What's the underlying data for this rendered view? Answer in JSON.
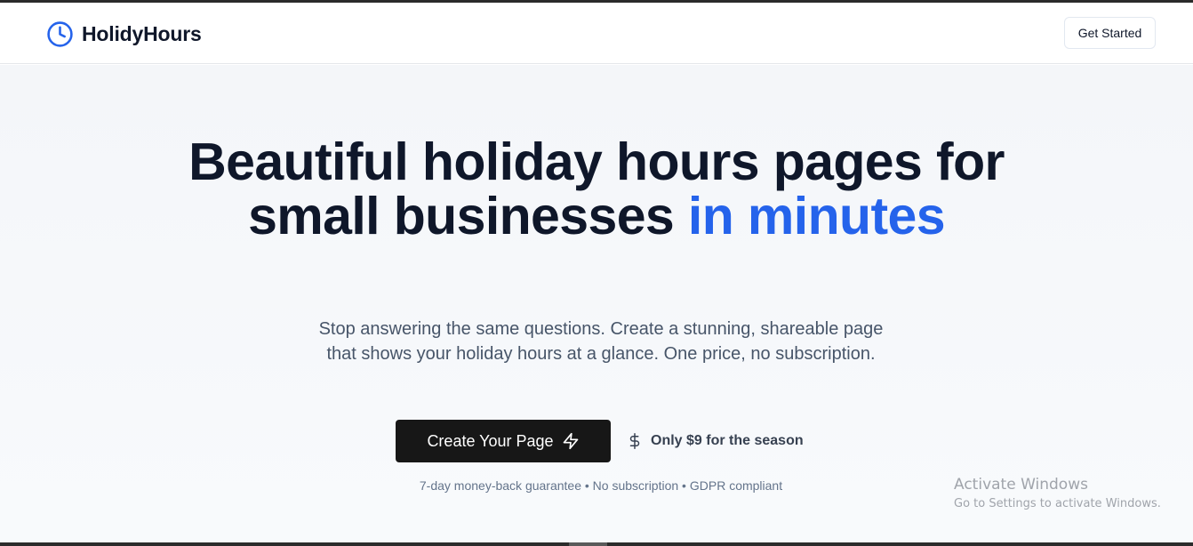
{
  "app": {
    "name": "HolidyHours",
    "logo_icon": "clock-icon",
    "accent_color": "#2563eb"
  },
  "header": {
    "get_started_label": "Get Started"
  },
  "hero": {
    "headline_part1": "Beautiful holiday hours pages for small businesses ",
    "headline_accent": "in minutes",
    "subtext": "Stop answering the same questions. Create a stunning, shareable page that shows your holiday hours at a glance. One price, no subscription.",
    "cta_label": "Create Your Page",
    "cta_icon": "lightning-icon",
    "price_icon": "dollar-icon",
    "price_label": "Only $9 for the season",
    "guarantees": "7-day money-back guarantee • No subscription • GDPR compliant"
  },
  "overlay": {
    "title": "Activate Windows",
    "subtitle": "Go to Settings to activate Windows."
  }
}
